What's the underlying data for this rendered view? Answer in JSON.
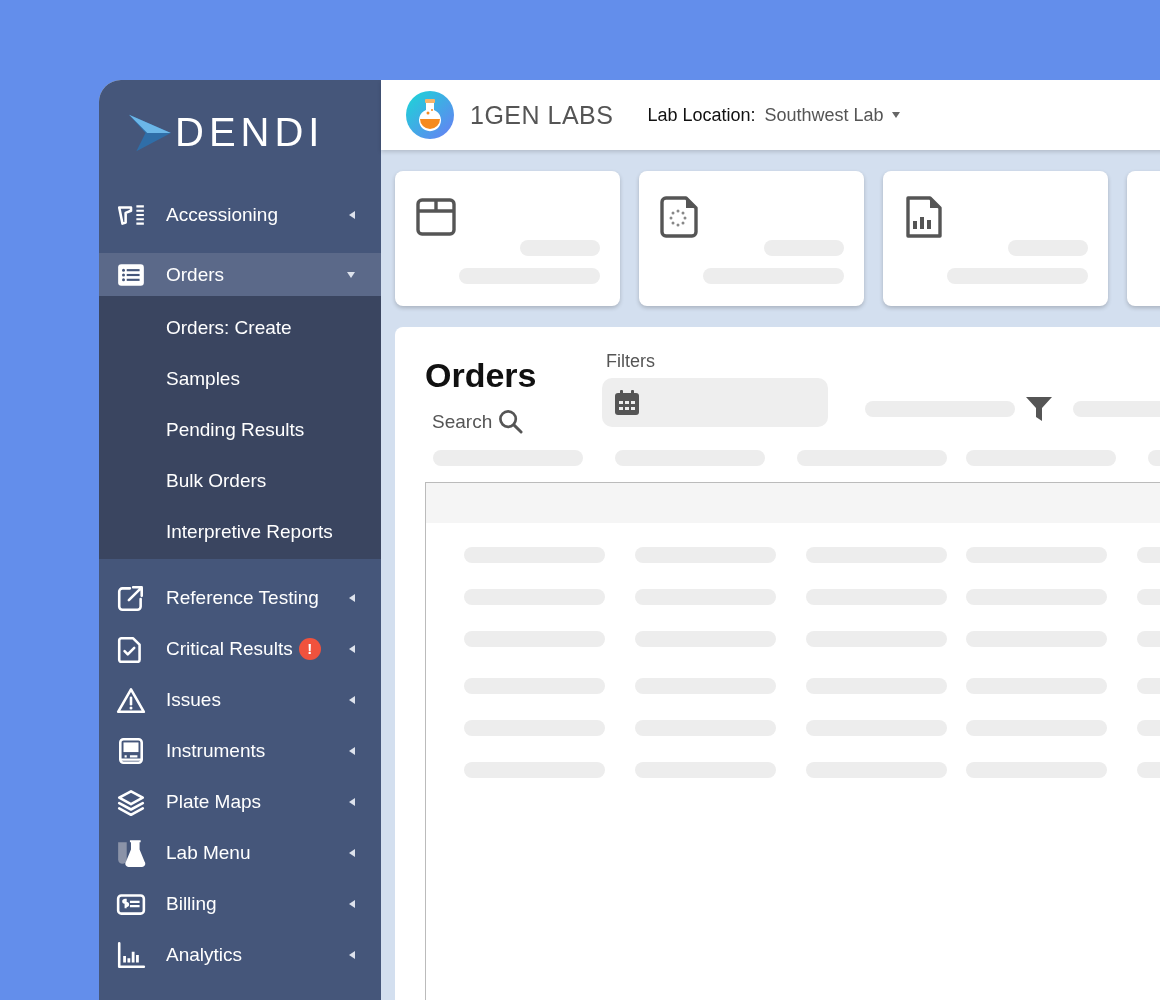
{
  "sidebar": {
    "logo": "DENDI",
    "items": [
      {
        "label": "Accessioning",
        "expanded": false,
        "selected": false
      },
      {
        "label": "Orders",
        "expanded": true,
        "selected": true,
        "children": [
          {
            "label": "Orders: Create"
          },
          {
            "label": "Samples"
          },
          {
            "label": "Pending Results"
          },
          {
            "label": "Bulk Orders"
          },
          {
            "label": "Interpretive Reports"
          }
        ]
      },
      {
        "label": "Reference Testing",
        "expanded": false,
        "selected": false
      },
      {
        "label": "Critical Results",
        "expanded": false,
        "selected": false,
        "badge": "!"
      },
      {
        "label": "Issues",
        "expanded": false,
        "selected": false
      },
      {
        "label": "Instruments",
        "expanded": false,
        "selected": false
      },
      {
        "label": "Plate Maps",
        "expanded": false,
        "selected": false
      },
      {
        "label": "Lab Menu",
        "expanded": false,
        "selected": false
      },
      {
        "label": "Billing",
        "expanded": false,
        "selected": false
      },
      {
        "label": "Analytics",
        "expanded": false,
        "selected": false
      }
    ]
  },
  "header": {
    "brand": "1GEN LABS",
    "location_label": "Lab Location:",
    "location": "Southwest Lab"
  },
  "main": {
    "title": "Orders",
    "search_label": "Search",
    "filters_label": "Filters"
  }
}
